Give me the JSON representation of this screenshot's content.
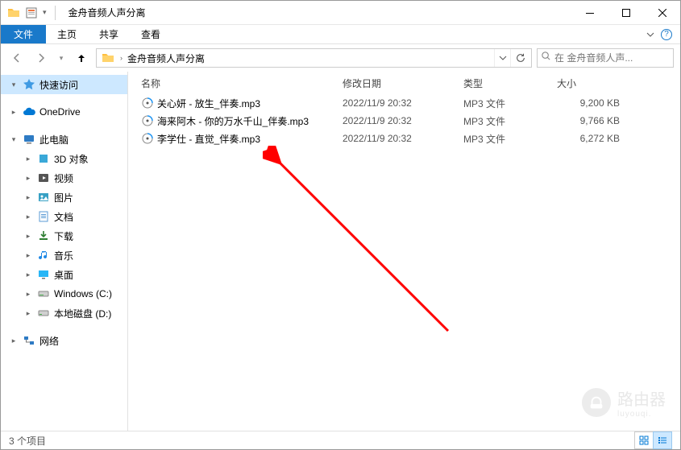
{
  "titlebar": {
    "title": "金舟音频人声分离"
  },
  "ribbon": {
    "file": "文件",
    "tabs": [
      "主页",
      "共享",
      "查看"
    ]
  },
  "address": {
    "segment": "金舟音频人声分离",
    "search_placeholder": "在 金舟音频人声..."
  },
  "sidebar": {
    "quick": "快速访问",
    "onedrive": "OneDrive",
    "thispc": "此电脑",
    "pc_items": [
      {
        "label": "3D 对象",
        "color": "#3aa8d8"
      },
      {
        "label": "视频",
        "color": "#555"
      },
      {
        "label": "图片",
        "color": "#37a0c4"
      },
      {
        "label": "文档",
        "color": "#5b9bd5"
      },
      {
        "label": "下载",
        "color": "#2e7d32"
      },
      {
        "label": "音乐",
        "color": "#1e88e5"
      },
      {
        "label": "桌面",
        "color": "#29b6f6"
      },
      {
        "label": "Windows (C:)",
        "color": "#888"
      },
      {
        "label": "本地磁盘 (D:)",
        "color": "#888"
      }
    ],
    "network": "网络"
  },
  "columns": {
    "name": "名称",
    "date": "修改日期",
    "type": "类型",
    "size": "大小"
  },
  "files": [
    {
      "name": "关心妍 - 放生_伴奏.mp3",
      "date": "2022/11/9 20:32",
      "type": "MP3 文件",
      "size": "9,200 KB"
    },
    {
      "name": "海来阿木 - 你的万水千山_伴奏.mp3",
      "date": "2022/11/9 20:32",
      "type": "MP3 文件",
      "size": "9,766 KB"
    },
    {
      "name": "李学仕 - 直觉_伴奏.mp3",
      "date": "2022/11/9 20:32",
      "type": "MP3 文件",
      "size": "6,272 KB"
    }
  ],
  "status": {
    "count": "3 个项目"
  },
  "watermark": {
    "text": "路由器",
    "sub": "luyouqi."
  }
}
